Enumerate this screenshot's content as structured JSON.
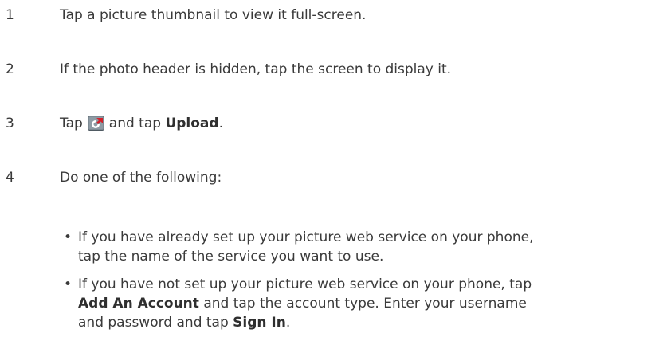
{
  "steps": [
    {
      "number": "1",
      "text": "Tap a picture thumbnail to view it full-screen."
    },
    {
      "number": "2",
      "text": "If the photo header is hidden, tap the screen to display it."
    },
    {
      "number": "3",
      "text_before": "Tap",
      "icon": "share-menu-icon",
      "text_middle": "and tap",
      "bold": "Upload",
      "text_after": "."
    },
    {
      "number": "4",
      "text": "Do one of the following:"
    }
  ],
  "bullets": [
    {
      "line1": "If you have already set up your picture web service on your phone,",
      "line2": "tap the name of the service you want to use."
    },
    {
      "line1": "If you have not set up your picture web service on your phone, tap",
      "line2_bold": "Add An Account",
      "line2_rest": "and tap the account type. Enter your username",
      "line3_before": "and password and tap",
      "line3_bold": "Sign In",
      "line3_after": "."
    }
  ],
  "colors": {
    "text": "#3a3a3a",
    "icon_background": "#7d8a93",
    "icon_arrow": "#d3202a"
  }
}
